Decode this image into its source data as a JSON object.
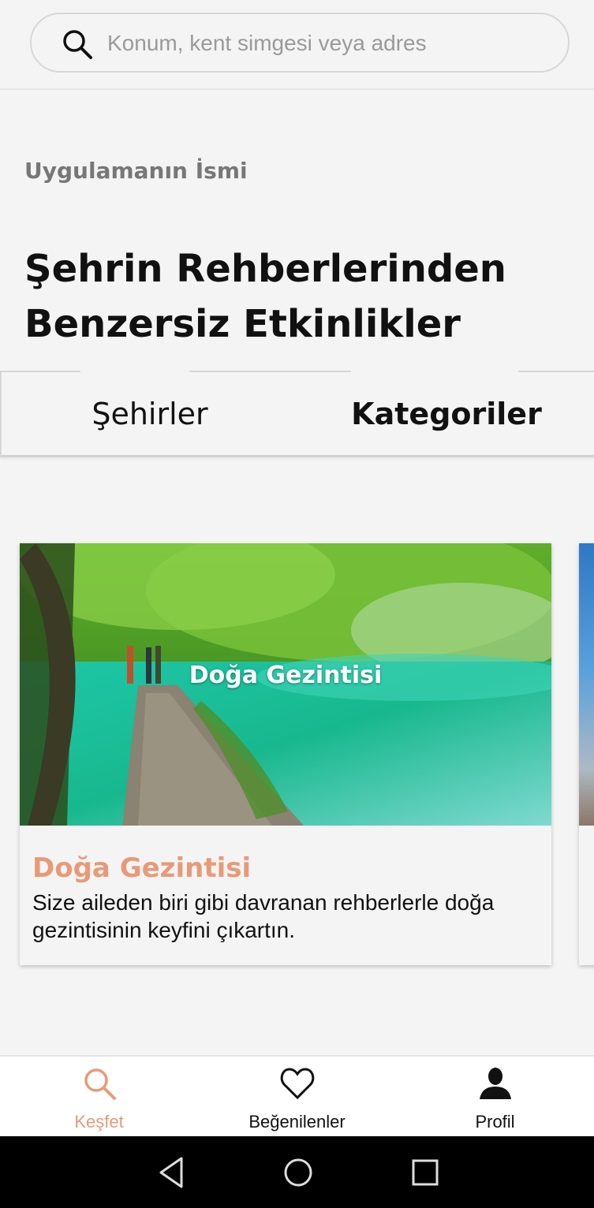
{
  "search": {
    "placeholder": "Konum, kent simgesi veya adres",
    "icon": "search-icon"
  },
  "app_name": "Uygulamanın İsmi",
  "headline": "Şehrin Rehberlerinden Benzersiz Etkinlikler",
  "tabs": [
    {
      "label": "Şehirler",
      "selected": false
    },
    {
      "label": "Kategoriler",
      "selected": true
    }
  ],
  "cards": [
    {
      "image_caption": "Doğa Gezintisi",
      "title": "Doğa Gezintisi",
      "description": "Size aileden biri gibi davranan rehberlerle doğa gezintisinin keyfini çıkartın."
    }
  ],
  "bottom_nav": [
    {
      "label": "Keşfet",
      "icon": "search-icon",
      "active": true
    },
    {
      "label": "Beğenilenler",
      "icon": "heart-icon",
      "active": false
    },
    {
      "label": "Profil",
      "icon": "person-icon",
      "active": false
    }
  ],
  "system_nav": [
    "back-icon",
    "home-icon",
    "recents-icon"
  ],
  "colors": {
    "accent": "#e89a78",
    "background": "#f4f4f4",
    "text": "#111111"
  }
}
